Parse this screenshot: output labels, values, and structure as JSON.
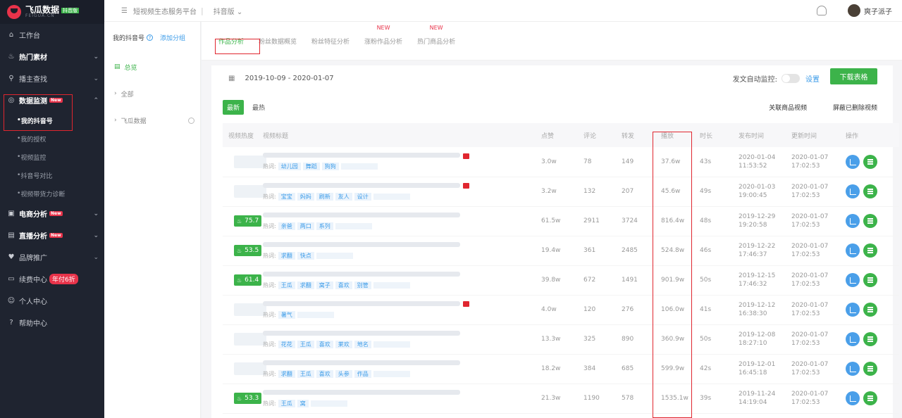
{
  "brand": {
    "title": "飞瓜数据",
    "edition": "抖音版",
    "subtitle": "FEIGUA.CN"
  },
  "topbar": {
    "platform": "短视频生态服务平台",
    "version": "抖音版",
    "user_name": "爽子派子"
  },
  "sidebar": {
    "items": [
      {
        "label": "工作台",
        "icon": "home-icon"
      },
      {
        "label": "热门素材",
        "icon": "flame-icon"
      },
      {
        "label": "播主查找",
        "icon": "search-icon"
      },
      {
        "label": "数据监测",
        "icon": "monitor-icon",
        "badge": "New"
      },
      {
        "label": "电商分析",
        "icon": "shop-icon",
        "badge": "New"
      },
      {
        "label": "直播分析",
        "icon": "live-icon",
        "badge": "New"
      },
      {
        "label": "品牌推广",
        "icon": "heart-icon"
      },
      {
        "label": "续费中心",
        "icon": "card-icon",
        "badge": "年付6折"
      },
      {
        "label": "个人中心",
        "icon": "user-icon"
      },
      {
        "label": "帮助中心",
        "icon": "help-icon"
      }
    ],
    "sub_items": [
      "我的抖音号",
      "我的授权",
      "视频监控",
      "抖音号对比",
      "视频带货力诊断"
    ]
  },
  "account_panel": {
    "header": "我的抖音号",
    "add_group": "添加分组",
    "overview": "总览",
    "all": "全部",
    "feigua": "飞瓜数据"
  },
  "tabs": [
    {
      "label": "作品分析",
      "active": true,
      "new": ""
    },
    {
      "label": "粉丝数据概览",
      "new": ""
    },
    {
      "label": "粉丝特征分析",
      "new": ""
    },
    {
      "label": "涨粉作品分析",
      "new": "NEW"
    },
    {
      "label": "热门商品分析",
      "new": "NEW"
    }
  ],
  "toolbar": {
    "date_range": "2019-10-09 - 2020-01-07",
    "auto_monitor": "发文自动监控:",
    "settings": "设置",
    "download": "下载表格",
    "filter_new": "最新",
    "filter_hot": "最热",
    "link_goods": "关联商品视频",
    "hide_deleted": "屏蔽已删除视频"
  },
  "table": {
    "columns": [
      "视频热度",
      "视频标题",
      "点赞",
      "评论",
      "转发",
      "播放",
      "时长",
      "发布时间",
      "更新时间",
      "操作"
    ],
    "hot_prefix": "热词:",
    "rows": [
      {
        "heat": "",
        "red": true,
        "tags": [
          "幼儿园",
          "舞蹈",
          "狗狗"
        ],
        "likes": "3.0w",
        "comments": "78",
        "shares": "149",
        "plays": "37.6w",
        "duration": "43s",
        "pub_date": "2020-01-04",
        "pub_time": "11:53:52",
        "upd_date": "2020-01-07",
        "upd_time": "17:02:53"
      },
      {
        "heat": "",
        "red": true,
        "tags": [
          "宝宝",
          "妈妈",
          "刷新",
          "友人",
          "设计"
        ],
        "likes": "3.2w",
        "comments": "132",
        "shares": "207",
        "plays": "45.6w",
        "duration": "49s",
        "pub_date": "2020-01-03",
        "pub_time": "19:00:45",
        "upd_date": "2020-01-07",
        "upd_time": "17:02:53"
      },
      {
        "heat": "75.7",
        "red": false,
        "tags": [
          "亲爸",
          "两口",
          "系列"
        ],
        "likes": "61.5w",
        "comments": "2911",
        "shares": "3724",
        "plays": "816.4w",
        "duration": "48s",
        "pub_date": "2019-12-29",
        "pub_time": "19:20:58",
        "upd_date": "2020-01-07",
        "upd_time": "17:02:53"
      },
      {
        "heat": "53.5",
        "red": false,
        "tags": [
          "求翻",
          "快点"
        ],
        "likes": "19.4w",
        "comments": "361",
        "shares": "2485",
        "plays": "524.8w",
        "duration": "46s",
        "pub_date": "2019-12-22",
        "pub_time": "17:46:37",
        "upd_date": "2020-01-07",
        "upd_time": "17:02:53"
      },
      {
        "heat": "61.4",
        "red": false,
        "tags": [
          "王瓜",
          "求翻",
          "窝子",
          "喜欢",
          "别管"
        ],
        "likes": "39.8w",
        "comments": "672",
        "shares": "1491",
        "plays": "901.9w",
        "duration": "50s",
        "pub_date": "2019-12-15",
        "pub_time": "17:46:32",
        "upd_date": "2020-01-07",
        "upd_time": "17:02:53"
      },
      {
        "heat": "",
        "red": true,
        "tags": [
          "暑气"
        ],
        "likes": "4.0w",
        "comments": "120",
        "shares": "276",
        "plays": "106.0w",
        "duration": "41s",
        "pub_date": "2019-12-12",
        "pub_time": "16:38:30",
        "upd_date": "2020-01-07",
        "upd_time": "17:02:53"
      },
      {
        "heat": "",
        "red": false,
        "tags": [
          "花花",
          "王瓜",
          "喜欢",
          "莱欢",
          "地名"
        ],
        "likes": "13.3w",
        "comments": "325",
        "shares": "890",
        "plays": "360.9w",
        "duration": "50s",
        "pub_date": "2019-12-08",
        "pub_time": "18:27:10",
        "upd_date": "2020-01-07",
        "upd_time": "17:02:53"
      },
      {
        "heat": "",
        "red": false,
        "tags": [
          "求翻",
          "王瓜",
          "喜欢",
          "头参",
          "作品"
        ],
        "likes": "18.2w",
        "comments": "384",
        "shares": "685",
        "plays": "599.9w",
        "duration": "42s",
        "pub_date": "2019-12-01",
        "pub_time": "16:45:18",
        "upd_date": "2020-01-07",
        "upd_time": "17:02:53"
      },
      {
        "heat": "53.3",
        "red": false,
        "tags": [
          "王瓜",
          "窝"
        ],
        "likes": "21.3w",
        "comments": "1190",
        "shares": "578",
        "plays": "1535.1w",
        "duration": "39s",
        "pub_date": "2019-11-24",
        "pub_time": "14:19:04",
        "upd_date": "2020-01-07",
        "upd_time": "17:02:53"
      }
    ]
  },
  "colors": {
    "accent_green": "#3cb34a",
    "link_blue": "#3b9be8",
    "alert_red": "#e0262f",
    "sidebar_bg": "#1f2430"
  }
}
